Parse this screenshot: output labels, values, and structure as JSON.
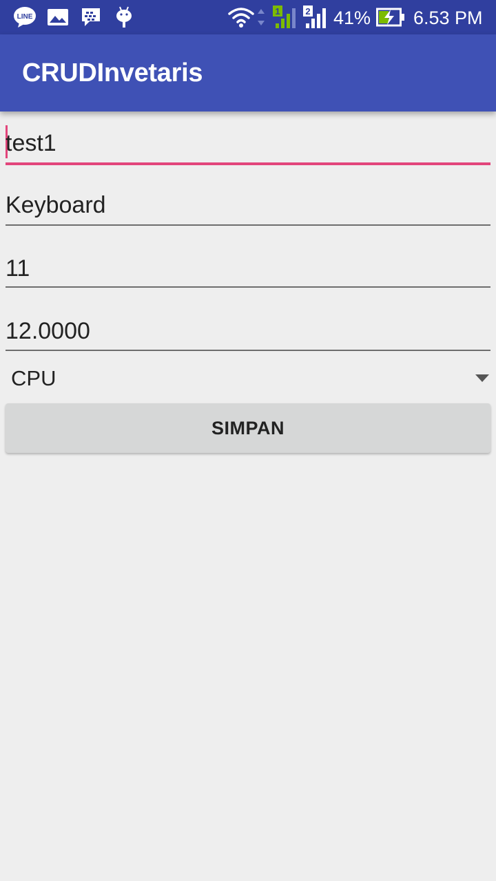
{
  "status_bar": {
    "notification_icons": [
      "line-app-icon",
      "gallery-icon",
      "bbm-icon",
      "android-debug-icon"
    ],
    "battery_percent": "41%",
    "time": "6.53 PM",
    "sim1_label": "1",
    "sim2_label": "2",
    "line_label": "LINE"
  },
  "app_bar": {
    "title": "CRUDInvetaris"
  },
  "form": {
    "field1_value": "test1",
    "field2_value": "Keyboard",
    "field3_value": "11",
    "field4_value": "12.0000",
    "spinner_value": "CPU",
    "submit_label": "SIMPAN"
  },
  "colors": {
    "status_bar": "#303f9f",
    "app_bar": "#3f51b5",
    "accent": "#e2457b",
    "background": "#eeeeee",
    "button": "#d6d7d7"
  }
}
